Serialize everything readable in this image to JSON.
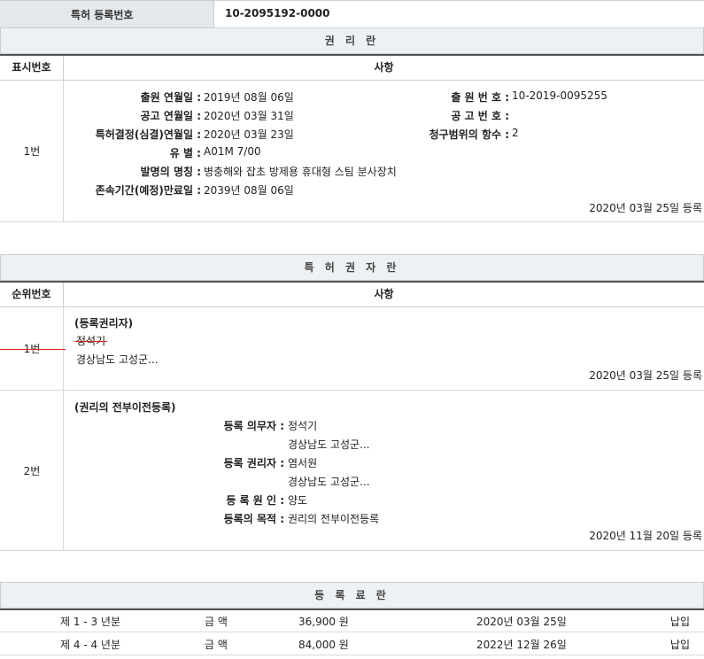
{
  "patent_no": {
    "label": "특허 등록번호",
    "value": "10-2095192-0000"
  },
  "rights": {
    "title": "권 리 란",
    "col_num": "표시번호",
    "col_detail": "사항",
    "row_num": "1번",
    "fields": {
      "filing_date_label": "출원 연월일 :",
      "filing_date": "2019년 08월 06일",
      "filing_no_label": "출 원 번 호 :",
      "filing_no": "10-2019-0095255",
      "pub_date_label": "공고 연월일 :",
      "pub_date": "2020년 03월 31일",
      "pub_no_label": "공 고 번 호 :",
      "pub_no": "",
      "decision_date_label": "특허결정(심결)연월일 :",
      "decision_date": "2020년 03월 23일",
      "claims_label": "청구범위의 항수 :",
      "claims": "2",
      "class_label": "유 별 :",
      "class": "A01M 7/00",
      "invention_label": "발명의 명칭 :",
      "invention": "병충해와 잡초 방제용 휴대형 스팀 분사장치",
      "expiry_label": "존속기간(예정)만료일 :",
      "expiry": "2039년 08월 06일"
    },
    "registered": "2020년 03월 25일 등록"
  },
  "holders": {
    "title": "특 허 권 자 란",
    "col_num": "순위번호",
    "col_detail": "사항",
    "row1": {
      "num": "1번",
      "heading": "(등록권리자)",
      "name": "정석기",
      "address": "경상남도 고성군...",
      "registered": "2020년 03월 25일 등록"
    },
    "row2": {
      "num": "2번",
      "heading": "(권리의 전부이전등록)",
      "obligor_label": "등록 의무자 :",
      "obligor": "정석기",
      "obligor_address": "경상남도 고성군...",
      "holder_label": "등록 권리자 :",
      "holder": "염서원",
      "holder_address": "경상남도 고성군...",
      "cause_label": "등 록 원 인 :",
      "cause": "양도",
      "purpose_label": "등록의 목적 :",
      "purpose": "권리의 전부이전등록",
      "registered": "2020년 11월 20일 등록"
    }
  },
  "fees": {
    "title": "등 록 료 란",
    "rows": [
      {
        "years": "제 1 - 3 년분",
        "amount_label": "금 액",
        "amount": "36,900 원",
        "date": "2020년 03월 25일",
        "status": "납입"
      },
      {
        "years": "제 4 - 4 년분",
        "amount_label": "금 액",
        "amount": "84,000 원",
        "date": "2022년 12월 26일",
        "status": "납입"
      }
    ]
  }
}
